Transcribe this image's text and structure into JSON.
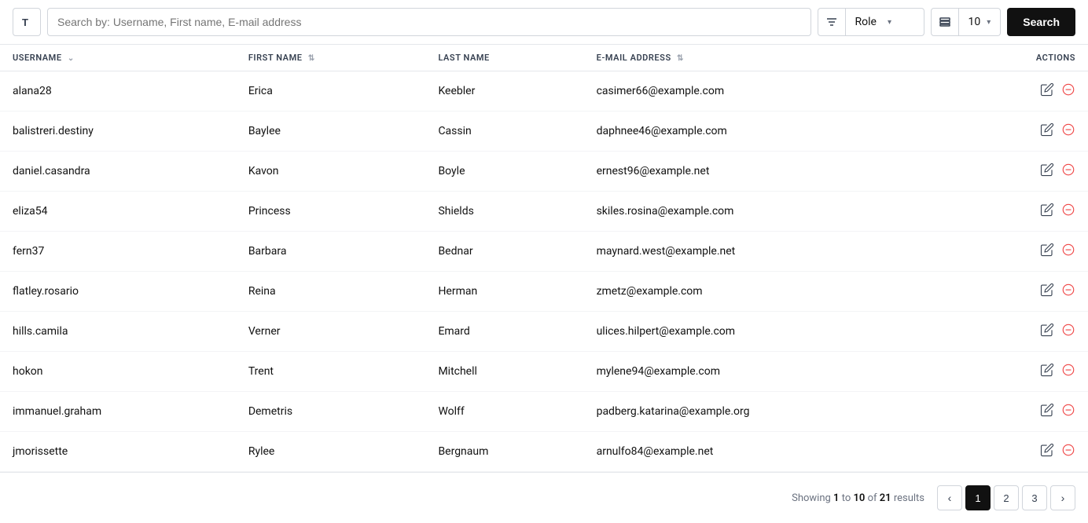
{
  "toolbar": {
    "search_placeholder": "Search by: Username, First name, E-mail address",
    "role_label": "Role",
    "rows_label": "10",
    "search_button": "Search"
  },
  "table": {
    "columns": [
      {
        "key": "username",
        "label": "USERNAME",
        "sortable": true
      },
      {
        "key": "first_name",
        "label": "FIRST NAME",
        "sortable": true
      },
      {
        "key": "last_name",
        "label": "LAST NAME",
        "sortable": false
      },
      {
        "key": "email",
        "label": "E-MAIL ADDRESS",
        "sortable": true
      },
      {
        "key": "actions",
        "label": "ACTIONS",
        "sortable": false
      }
    ],
    "rows": [
      {
        "username": "alana28",
        "first_name": "Erica",
        "last_name": "Keebler",
        "email": "casimer66@example.com"
      },
      {
        "username": "balistreri.destiny",
        "first_name": "Baylee",
        "last_name": "Cassin",
        "email": "daphnee46@example.com"
      },
      {
        "username": "daniel.casandra",
        "first_name": "Kavon",
        "last_name": "Boyle",
        "email": "ernest96@example.net"
      },
      {
        "username": "eliza54",
        "first_name": "Princess",
        "last_name": "Shields",
        "email": "skiles.rosina@example.com"
      },
      {
        "username": "fern37",
        "first_name": "Barbara",
        "last_name": "Bednar",
        "email": "maynard.west@example.net"
      },
      {
        "username": "flatley.rosario",
        "first_name": "Reina",
        "last_name": "Herman",
        "email": "zmetz@example.com"
      },
      {
        "username": "hills.camila",
        "first_name": "Verner",
        "last_name": "Emard",
        "email": "ulices.hilpert@example.com"
      },
      {
        "username": "hokon",
        "first_name": "Trent",
        "last_name": "Mitchell",
        "email": "mylene94@example.com"
      },
      {
        "username": "immanuel.graham",
        "first_name": "Demetris",
        "last_name": "Wolff",
        "email": "padberg.katarina@example.org"
      },
      {
        "username": "jmorissette",
        "first_name": "Rylee",
        "last_name": "Bergnaum",
        "email": "arnulfo84@example.net"
      }
    ]
  },
  "pagination": {
    "info_prefix": "Showing",
    "current_start": "1",
    "current_end": "10",
    "total": "21",
    "info_suffix": "results",
    "current_page": 1,
    "pages": [
      "1",
      "2",
      "3"
    ]
  }
}
